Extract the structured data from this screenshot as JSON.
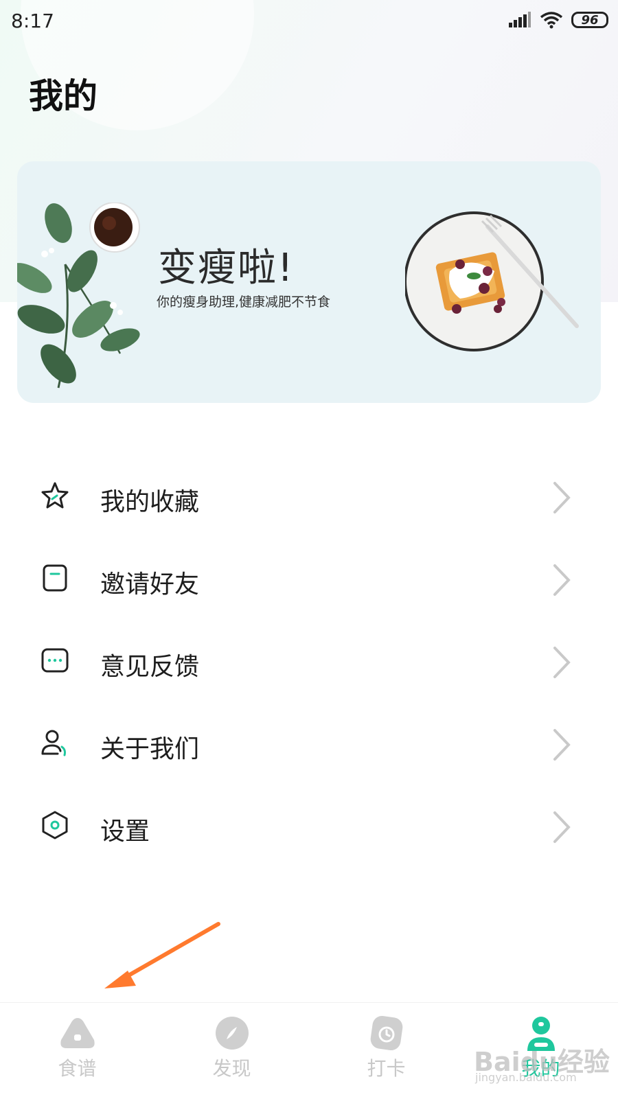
{
  "status_bar": {
    "time": "8:17",
    "battery": "96"
  },
  "page": {
    "title": "我的"
  },
  "banner": {
    "title": "变瘦啦!",
    "subtitle": "你的瘦身助理,健康减肥不节食"
  },
  "menu": [
    {
      "label": "我的收藏",
      "icon": "star-icon"
    },
    {
      "label": "邀请好友",
      "icon": "invite-card-icon"
    },
    {
      "label": "意见反馈",
      "icon": "feedback-chat-icon"
    },
    {
      "label": "关于我们",
      "icon": "person-icon"
    },
    {
      "label": "设置",
      "icon": "hexagon-settings-icon"
    }
  ],
  "tab_bar": {
    "active_index": 3,
    "tabs": [
      {
        "label": "食谱",
        "icon": "recipe-icon"
      },
      {
        "label": "发现",
        "icon": "discover-icon"
      },
      {
        "label": "打卡",
        "icon": "clock-icon"
      },
      {
        "label": "我的",
        "icon": "profile-icon"
      }
    ]
  },
  "watermark": {
    "text": "Baidu经验",
    "url": "jingyan.baidu.com"
  },
  "colors": {
    "accent": "#1fc79d",
    "inactive": "#c8c8c8",
    "banner_bg": "#e8f3f6",
    "annotation": "#ff7a2e"
  }
}
